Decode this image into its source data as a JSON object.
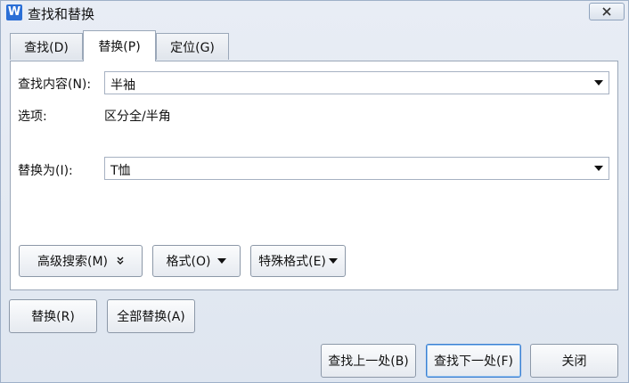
{
  "window": {
    "title": "查找和替换",
    "app_icon_letter": "W",
    "icons": {
      "app": "wps-writer-icon",
      "close": "close-icon"
    }
  },
  "tabs": [
    {
      "label": "查找(D)",
      "active": false
    },
    {
      "label": "替换(P)",
      "active": true
    },
    {
      "label": "定位(G)",
      "active": false
    }
  ],
  "find": {
    "label": "查找内容(N):",
    "value": "半袖"
  },
  "options": {
    "label": "选项:",
    "value": "区分全/半角"
  },
  "replace": {
    "label": "替换为(I):",
    "value": "T恤"
  },
  "panel_buttons": {
    "advanced_search": "高级搜索(M)",
    "format": "格式(O)",
    "special_format": "特殊格式(E)"
  },
  "action_buttons": {
    "replace": "替换(R)",
    "replace_all": "全部替换(A)",
    "find_previous": "查找上一处(B)",
    "find_next": "查找下一处(F)",
    "close": "关闭"
  },
  "colors": {
    "accent": "#2b6fd6",
    "focus": "#3c7fd1"
  }
}
